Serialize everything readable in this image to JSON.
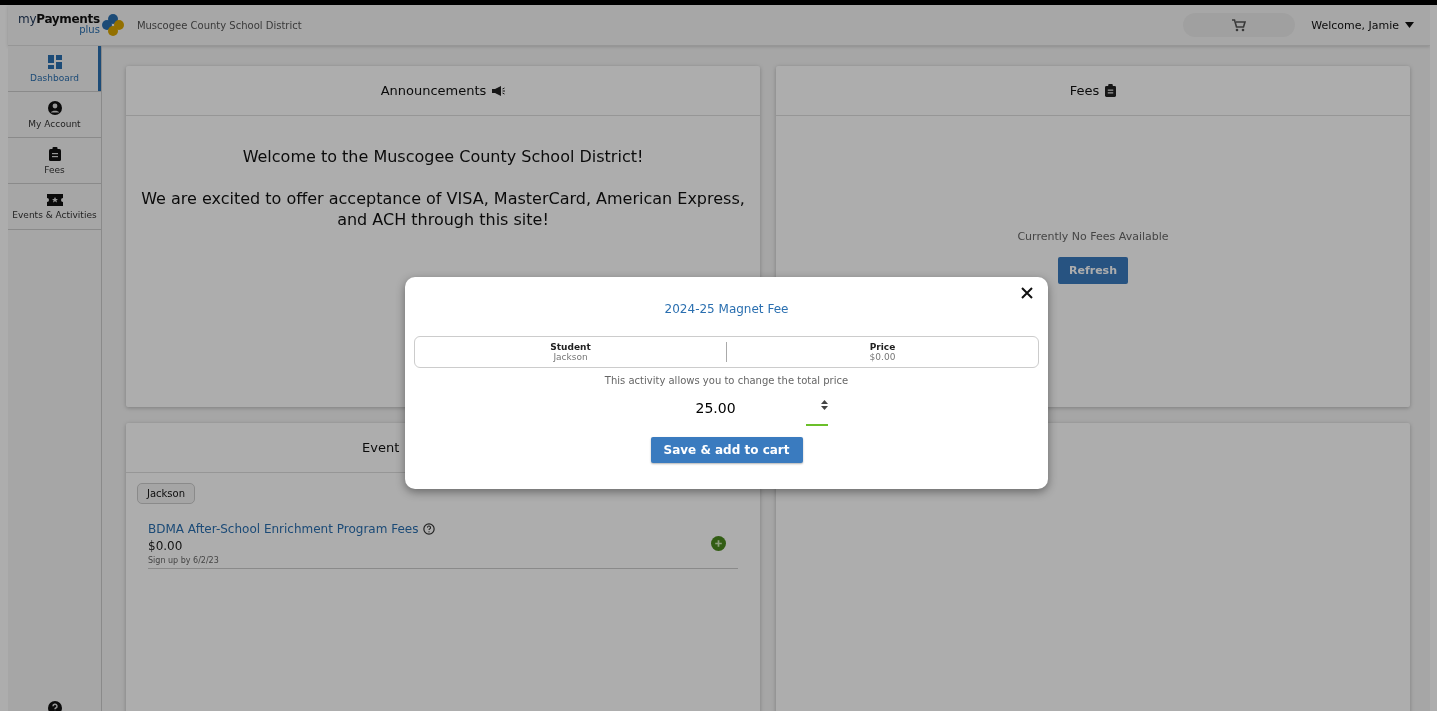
{
  "header": {
    "logo": "my**Payments**",
    "logo_sub": "plus",
    "district": "Muscogee County School District",
    "welcome": "Welcome, Jamie"
  },
  "sidebar": {
    "items": [
      {
        "kind": "dashboard",
        "label": "Dashboard",
        "selected": true
      },
      {
        "kind": "account",
        "label": "My Account",
        "selected": false
      },
      {
        "kind": "fees",
        "label": "Fees",
        "selected": false
      },
      {
        "kind": "events",
        "label": "Events & Activities",
        "selected": false
      }
    ]
  },
  "announcements": {
    "title": "Announcements",
    "paragraphs": [
      "Welcome to the Muscogee County School District!",
      "We are excited to offer acceptance of VISA, MasterCard, American Express, and ACH through this site!"
    ]
  },
  "fees": {
    "title": "Fees",
    "empty_text": "Currently No Fees Available",
    "refresh_button": "Refresh"
  },
  "events": {
    "title": "Event",
    "student_chip": "Jackson",
    "items": [
      {
        "name": "BDMA After-School Enrichment Program Fees",
        "price": "$0.00",
        "signup": "Sign up by 6/2/23"
      }
    ]
  },
  "modal": {
    "title": "2024-25 Magnet Fee",
    "columns": [
      {
        "heading": "Student",
        "value": "Jackson"
      },
      {
        "heading": "Price",
        "value": "$0.00"
      }
    ],
    "note": "This activity allows you to change the total price",
    "amount": "25.00",
    "save_button": "Save & add to cart"
  }
}
